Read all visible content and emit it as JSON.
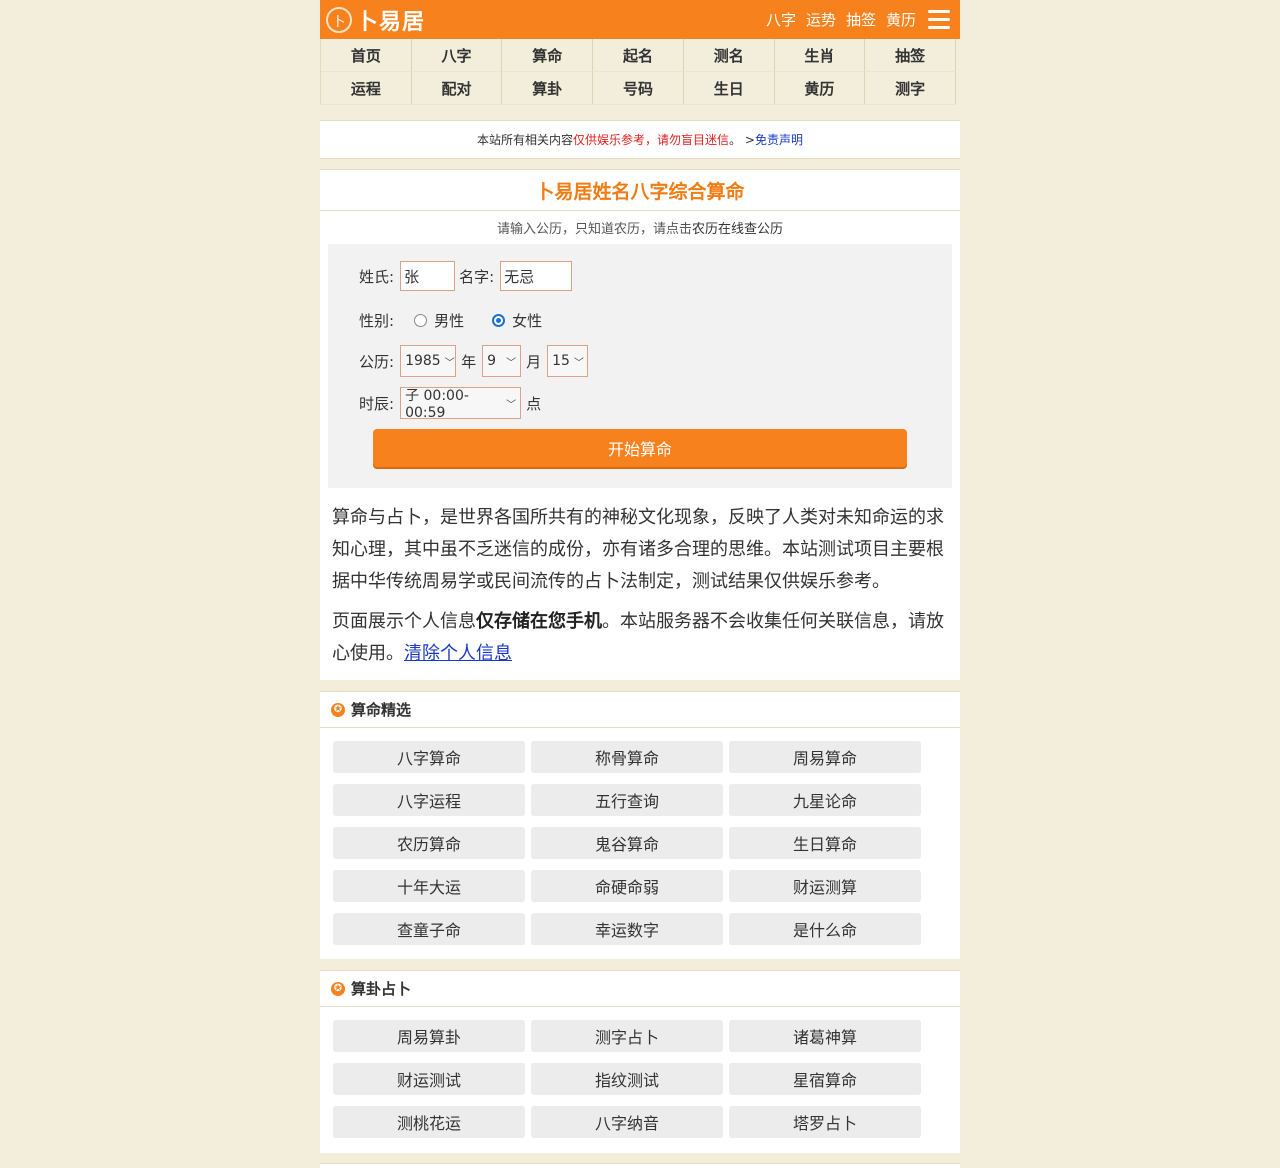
{
  "header": {
    "logo_mark": "卜",
    "logo_text": "卜易居",
    "top_links": [
      "八字",
      "运势",
      "抽签",
      "黄历"
    ],
    "menu_icon": "hamburger-menu-icon"
  },
  "nav": [
    "首页",
    "八字",
    "算命",
    "起名",
    "测名",
    "生肖",
    "抽签",
    "运程",
    "配对",
    "算卦",
    "号码",
    "生日",
    "黄历",
    "测字"
  ],
  "notice": {
    "prefix": "本站所有相关内容",
    "red": "仅供娱乐参考，请勿盲目迷信",
    "mid": "。 > ",
    "link": "免责声明"
  },
  "main": {
    "title": "卜易居姓名八字综合算命",
    "hint_prefix": "请输入公历，只知道农历，请点击",
    "hint_link": "农历在线查公历",
    "form": {
      "surname_label": "姓氏:",
      "surname_value": "张",
      "name_label": "名字:",
      "name_value": "无忌",
      "gender_label": "性别:",
      "male": "男性",
      "female": "女性",
      "gender_selected": "female",
      "date_label": "公历:",
      "year": "1985",
      "year_unit": "年",
      "month": "9",
      "month_unit": "月",
      "day": "15",
      "hour_label": "时辰:",
      "hour": "子 00:00-00:59",
      "hour_unit": "点",
      "submit": "开始算命"
    },
    "para1": "算命与占卜，是世界各国所共有的神秘文化现象，反映了人类对未知命运的求知心理，其中虽不乏迷信的成份，亦有诸多合理的思维。本站测试项目主要根据中华传统周易学或民间流传的占卜法制定，测试结果仅供娱乐参考。",
    "para2_prefix": "页面展示个人信息",
    "para2_bold": "仅存储在您手机",
    "para2_mid": "。本站服务器不会收集任何关联信息，请放心使用。",
    "para2_link": "清除个人信息"
  },
  "sections": [
    {
      "title": "算命精选",
      "items": [
        "八字算命",
        "称骨算命",
        "周易算命",
        "八字运程",
        "五行查询",
        "九星论命",
        "农历算命",
        "鬼谷算命",
        "生日算命",
        "十年大运",
        "命硬命弱",
        "财运测算",
        "查童子命",
        "幸运数字",
        "是什么命"
      ]
    },
    {
      "title": "算卦占卜",
      "items": [
        "周易算卦",
        "测字占卜",
        "诸葛神算",
        "财运测试",
        "指纹测试",
        "星宿算命",
        "测桃花运",
        "八字纳音",
        "塔罗占卜"
      ]
    }
  ],
  "colors": {
    "brand": "#f7821d",
    "background": "#f3eedc",
    "link": "#1a39c9",
    "warning": "#e0201e"
  }
}
